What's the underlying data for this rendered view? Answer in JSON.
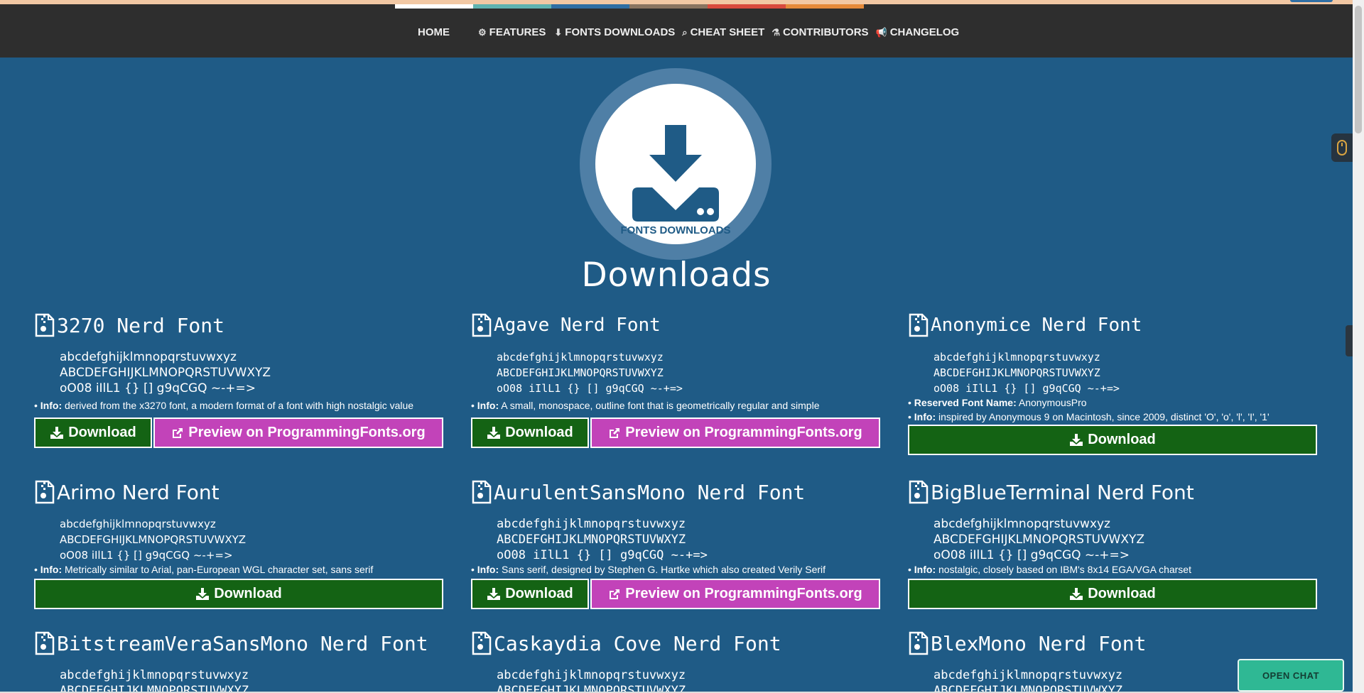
{
  "nav": {
    "items": [
      {
        "icon": "",
        "label": "HOME"
      },
      {
        "icon": "gears-icon",
        "label": "FEATURES"
      },
      {
        "icon": "download-icon",
        "label": "FONTS DOWNLOADS"
      },
      {
        "icon": "search-icon",
        "label": "CHEAT SHEET"
      },
      {
        "icon": "flask-icon",
        "label": "CONTRIBUTORS"
      },
      {
        "icon": "bullhorn-icon",
        "label": "CHANGELOG"
      }
    ],
    "colorbar": [
      "#ffffff",
      "#5fb3b0",
      "#2f6ea3",
      "#8a7460",
      "#d94a3d",
      "#e58a3a"
    ]
  },
  "hero": {
    "label": "FONTS DOWNLOADS"
  },
  "page_title": "Downloads",
  "buttons": {
    "download": "Download",
    "preview": "Preview on ProgrammingFonts.org"
  },
  "sample": {
    "lower": "abcdefghijklmnopqrstuvwxyz",
    "upper": "ABCDEFGHIJKLMNOPQRSTUVWXYZ",
    "symbols_a": "oO08 iIlL1 {} [] g9qCGQ ~-+=>",
    "symbols_b": "oO08 iIlL1 {} [] g9qCGQ ~-+=>"
  },
  "info_label": "Info:",
  "reserved_label": "Reserved Font Name:",
  "fonts": [
    {
      "name": "3270 Nerd Font",
      "info": "derived from the x3270 font, a modern format of a font with high nostalgic value",
      "preview": true
    },
    {
      "name": "Agave Nerd Font",
      "info": "A small, monospace, outline font that is geometrically regular and simple",
      "preview": true
    },
    {
      "name": "Anonymice Nerd Font",
      "reserved": "AnonymousPro",
      "info": "inspired by Anonymous 9 on Macintosh, since 2009, distinct 'O', 'o', 'l', 'I', '1'",
      "preview": false
    },
    {
      "name": "Arimo Nerd Font",
      "info": "Metrically similar to Arial, pan-European WGL character set, sans serif",
      "preview": false
    },
    {
      "name": "AurulentSansMono Nerd Font",
      "info": "Sans serif, designed by Stephen G. Hartke which also created Verily Serif",
      "preview": true
    },
    {
      "name": "BigBlueTerminal Nerd Font",
      "info": "nostalgic, closely based on IBM's 8x14 EGA/VGA charset",
      "preview": false
    },
    {
      "name": "BitstreamVeraSansMono Nerd Font"
    },
    {
      "name": "Caskaydia Cove Nerd Font"
    },
    {
      "name": "BlexMono Nerd Font"
    }
  ],
  "chat": {
    "label": "OPEN CHAT"
  }
}
